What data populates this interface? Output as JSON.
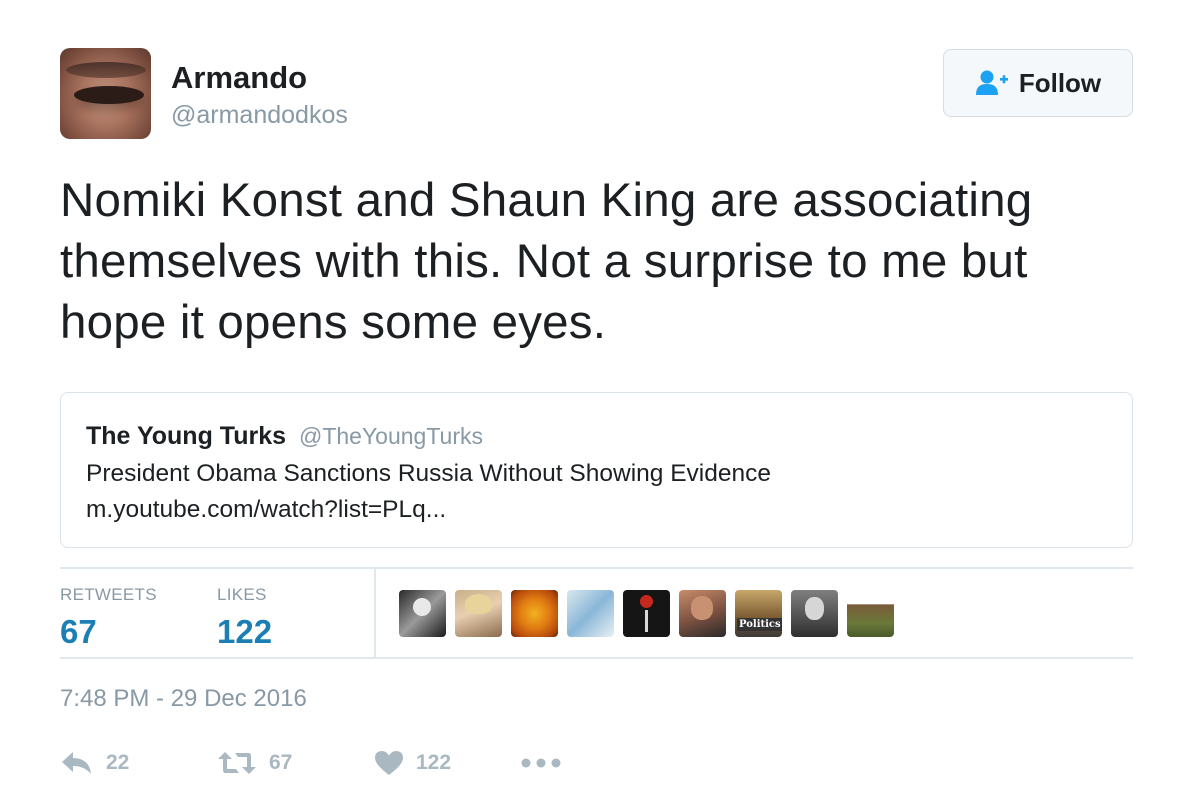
{
  "user": {
    "name": "Armando",
    "handle": "@armandodkos"
  },
  "follow_button": {
    "label": "Follow"
  },
  "tweet": {
    "lines": [
      "Nomiki Konst and Shaun King are associating",
      "themselves with this. Not a surprise to me but",
      "hope it opens some eyes."
    ]
  },
  "quote": {
    "name": "The Young Turks",
    "handle": "@TheYoungTurks",
    "text": "President Obama Sanctions Russia Without Showing Evidence",
    "link": "m.youtube.com/watch?list=PLq..."
  },
  "stats": {
    "retweets_label": "RETWEETS",
    "retweets_value": "67",
    "likes_label": "LIKES",
    "likes_value": "122"
  },
  "timestamp": "7:48 PM - 29 Dec 2016",
  "actions": {
    "reply_count": "22",
    "retweet_count": "67",
    "like_count": "122"
  },
  "colors": {
    "link_blue": "#1b7fb3",
    "muted_gray": "#8899a6",
    "icon_gray": "#aab8c2",
    "follow_icon_blue": "#1da1f2"
  },
  "icons": {
    "follow": "add-user-icon",
    "reply": "reply-icon",
    "retweet": "retweet-icon",
    "like": "heart-icon",
    "more": "more-dots-icon"
  }
}
